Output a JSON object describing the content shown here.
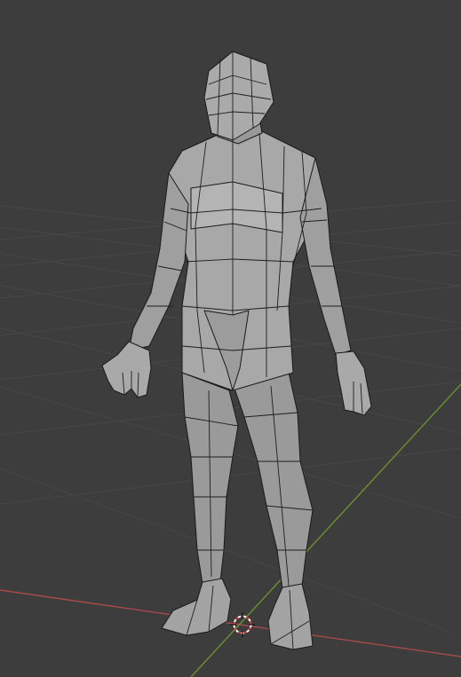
{
  "viewport": {
    "mode": "solid-shading",
    "background_color": "#3d3d3d",
    "grid_color": "#4a4a4a",
    "x_axis_color": "#a84a4a",
    "y_axis_color": "#6c8f2f",
    "mesh_fill_color": "#9e9e9e",
    "mesh_edge_color": "#1a1a1a"
  },
  "scene": {
    "object": "low-poly-humanoid-mesh",
    "cursor": "3d-cursor-icon"
  }
}
